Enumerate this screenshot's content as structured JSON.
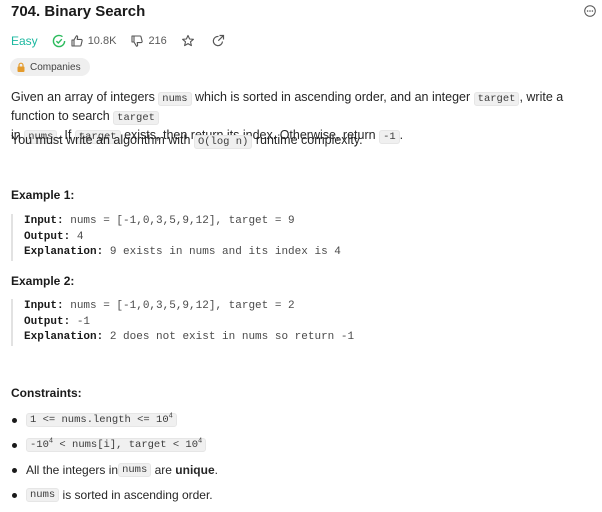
{
  "problem": {
    "title": "704. Binary Search",
    "difficulty": "Easy",
    "likes": "10.8K",
    "dislikes": "216",
    "companies_label": "Companies"
  },
  "description": {
    "p1_a": "Given an array of integers ",
    "p1_nums": "nums",
    "p1_b": " which is sorted in ascending order, and an integer ",
    "p1_target": "target",
    "p1_c": ", write a function to search ",
    "p1_target2": "target",
    "p1_d": "in ",
    "p1_nums2": "nums",
    "p1_e": ". If ",
    "p1_target3": "target",
    "p1_f": " exists, then return its index. Otherwise, return ",
    "p1_neg1": "-1",
    "p1_g": ".",
    "p2_a": "You must write an algorithm with ",
    "p2_code": "O(log n)",
    "p2_b": " runtime complexity."
  },
  "examples": [
    {
      "heading": "Example 1:",
      "input_label": "Input:",
      "input_value": "nums = [-1,0,3,5,9,12], target = 9",
      "output_label": "Output:",
      "output_value": "4",
      "explanation_label": "Explanation:",
      "explanation_value": "9 exists in nums and its index is 4"
    },
    {
      "heading": "Example 2:",
      "input_label": "Input:",
      "input_value": "nums = [-1,0,3,5,9,12], target = 2",
      "output_label": "Output:",
      "output_value": "-1",
      "explanation_label": "Explanation:",
      "explanation_value": "2 does not exist in nums so return -1"
    }
  ],
  "constraints": {
    "heading": "Constraints:",
    "c1_code": "1 <= nums.length <= 10",
    "c1_sup": "4",
    "c2_pre": "-10",
    "c2_sup1": "4",
    "c2_mid": " < nums[i], target < 10",
    "c2_sup2": "4",
    "c3_a": "All the integers in ",
    "c3_code": "nums",
    "c3_b": " are ",
    "c3_bold": "unique",
    "c3_c": ".",
    "c4_code": "nums",
    "c4_b": " is sorted in ascending order."
  },
  "icons": {
    "more": "more-options-icon",
    "solved": "check-circle-icon",
    "like": "thumbs-up-icon",
    "dislike": "thumbs-down-icon",
    "favorite": "star-icon",
    "share": "share-icon",
    "companies": "lock-icon"
  },
  "colors": {
    "easy": "#1cb8a0",
    "solved": "#2cbb5d"
  }
}
